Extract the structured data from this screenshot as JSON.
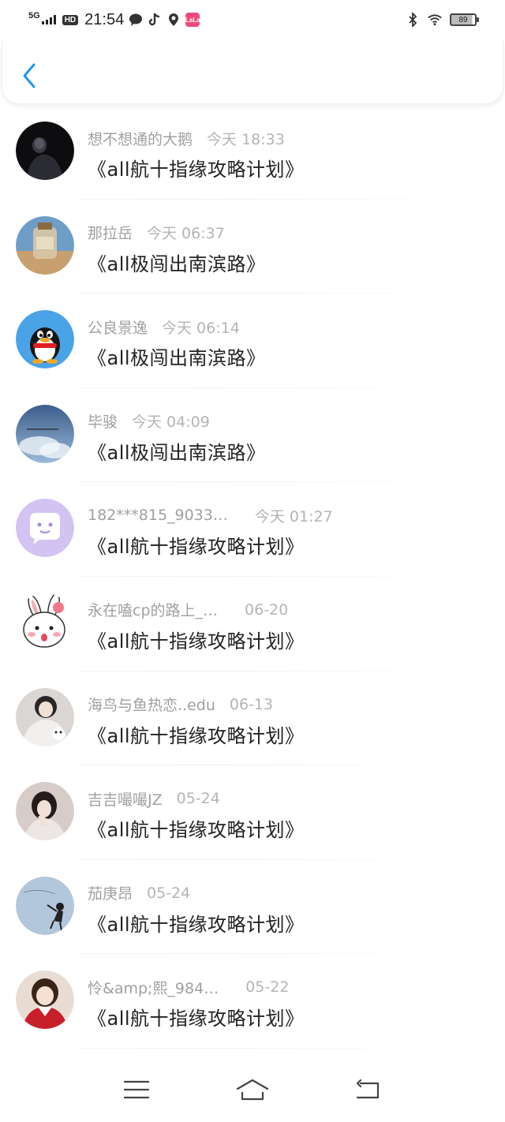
{
  "status_bar": {
    "network": "5G",
    "hd": "HD",
    "time": "21:54",
    "lala_label": "LaLa",
    "battery": "89",
    "icons": [
      "signal-icon",
      "message-bubble-icon",
      "tiktok-icon",
      "location-icon",
      "lala-app-icon",
      "bluetooth-icon",
      "wifi-icon",
      "battery-icon"
    ]
  },
  "header": {
    "back_icon": "chevron-left-icon",
    "accent_color": "#2196f3"
  },
  "items": [
    {
      "name": "想不想通的大鹅",
      "time": "今天 18:33",
      "title": "《all航十指缘攻略计划》"
    },
    {
      "name": "那拉岳",
      "time": "今天 06:37",
      "title": "《all极闯出南滨路》"
    },
    {
      "name": "公良景逸",
      "time": "今天 06:14",
      "title": "《all极闯出南滨路》"
    },
    {
      "name": "毕骏",
      "time": "今天 04:09",
      "title": "《all极闯出南滨路》"
    },
    {
      "name": "182***815_9033…",
      "time": "今天 01:27",
      "title": "《all航十指缘攻略计划》"
    },
    {
      "name": "永在嗑cp的路上_…",
      "time": "06-20",
      "title": "《all航十指缘攻略计划》"
    },
    {
      "name": "海鸟与鱼热恋..edu",
      "time": "06-13",
      "title": "《all航十指缘攻略计划》"
    },
    {
      "name": "吉吉嘬嘬JZ",
      "time": "05-24",
      "title": "《all航十指缘攻略计划》"
    },
    {
      "name": "茄庚昂",
      "time": "05-24",
      "title": "《all航十指缘攻略计划》"
    },
    {
      "name": "怜&amp;熙_984…",
      "time": "05-22",
      "title": "《all航十指缘攻略计划》"
    }
  ],
  "nav": {
    "icons": [
      "menu-icon",
      "home-icon",
      "back-icon"
    ]
  }
}
